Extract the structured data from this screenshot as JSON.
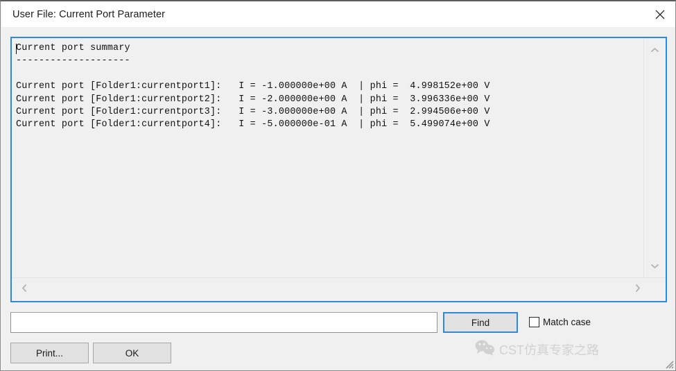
{
  "window": {
    "title": "User File: Current Port Parameter",
    "close_icon": "close-icon",
    "accent_color": "#2b8ae0",
    "face_color": "#f0f0f0",
    "button_color": "#e1e1e1"
  },
  "text_panel": {
    "content": "Current port summary\n--------------------\n\nCurrent port [Folder1:currentport1]:   I = -1.000000e+00 A  | phi =  4.998152e+00 V\nCurrent port [Folder1:currentport2]:   I = -2.000000e+00 A  | phi =  3.996336e+00 V\nCurrent port [Folder1:currentport3]:   I = -3.000000e+00 A  | phi =  2.994506e+00 V\nCurrent port [Folder1:currentport4]:   I = -5.000000e-01 A  | phi =  5.499074e+00 V",
    "heading": "Current port summary",
    "separator": "--------------------",
    "rows": [
      {
        "label": "Current port [Folder1:currentport1]:",
        "current_label": "I =",
        "current_value": "-1.000000e+00",
        "current_unit": "A",
        "phi_label": "phi =",
        "phi_value": "4.998152e+00",
        "phi_unit": "V"
      },
      {
        "label": "Current port [Folder1:currentport2]:",
        "current_label": "I =",
        "current_value": "-2.000000e+00",
        "current_unit": "A",
        "phi_label": "phi =",
        "phi_value": "3.996336e+00",
        "phi_unit": "V"
      },
      {
        "label": "Current port [Folder1:currentport3]:",
        "current_label": "I =",
        "current_value": "-3.000000e+00",
        "current_unit": "A",
        "phi_label": "phi =",
        "phi_value": "2.994506e+00",
        "phi_unit": "V"
      },
      {
        "label": "Current port [Folder1:currentport4]:",
        "current_label": "I =",
        "current_value": "-5.000000e-01",
        "current_unit": "A",
        "phi_label": "phi =",
        "phi_value": "5.499074e+00",
        "phi_unit": "V"
      }
    ]
  },
  "scrollbars": {
    "vertical_up_icon": "chevron-up-icon",
    "vertical_down_icon": "chevron-down-icon",
    "horizontal_left_icon": "chevron-left-icon",
    "horizontal_right_icon": "chevron-right-icon"
  },
  "find_bar": {
    "input_value": "",
    "input_placeholder": "",
    "find_label": "Find",
    "match_case_label": "Match case",
    "match_case_checked": false
  },
  "footer": {
    "print_label": "Print...",
    "ok_label": "OK"
  },
  "watermark": {
    "icon": "wechat-icon",
    "text": "CST仿真专家之路"
  }
}
